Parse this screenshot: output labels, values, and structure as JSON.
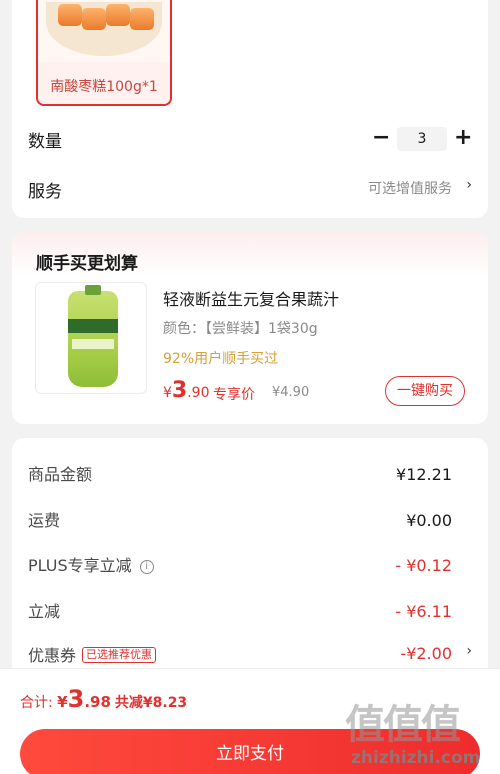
{
  "spec": {
    "label": "南酸枣糕100g*1"
  },
  "quantity": {
    "label": "数量",
    "minus": "−",
    "value": "3",
    "plus": "+"
  },
  "service": {
    "label": "服务",
    "hint": "可选增值服务",
    "chevron": "›"
  },
  "bundle": {
    "title": "顺手买更划算",
    "product": {
      "name": "轻液断益生元复合果蔬汁",
      "spec": "颜色：【尝鲜装】1袋30g",
      "buyers": "92%用户顺手买过",
      "price_cur": "¥",
      "price_int": "3",
      "price_dec": ".90",
      "price_tag": "专享价",
      "original_price": "¥4.90",
      "buy_button": "一键购买"
    }
  },
  "summary": {
    "rows": [
      {
        "label": "商品金额",
        "value": "¥12.21"
      },
      {
        "label": "运费",
        "value": "¥0.00"
      },
      {
        "label": "PLUS专享立减",
        "value": "- ¥0.12"
      },
      {
        "label": "立减",
        "value": "- ¥6.11"
      },
      {
        "label": "优惠券",
        "badge": "已选推荐优惠",
        "value": "-¥2.00",
        "chevron": "›"
      }
    ],
    "info_icon": "i"
  },
  "footer": {
    "total_label": "合计: ",
    "total_cur": "¥",
    "total_int": "3",
    "total_dec": ".98",
    "total_saving": "共减¥8.23",
    "pay_button": "立即支付"
  },
  "watermark": {
    "glyphs": "值值值",
    "text": "zhizhizhi.com"
  },
  "colors": {
    "accent": "#e0312f",
    "buyers_text": "#d6a03a",
    "background": "#f2f2f2"
  }
}
